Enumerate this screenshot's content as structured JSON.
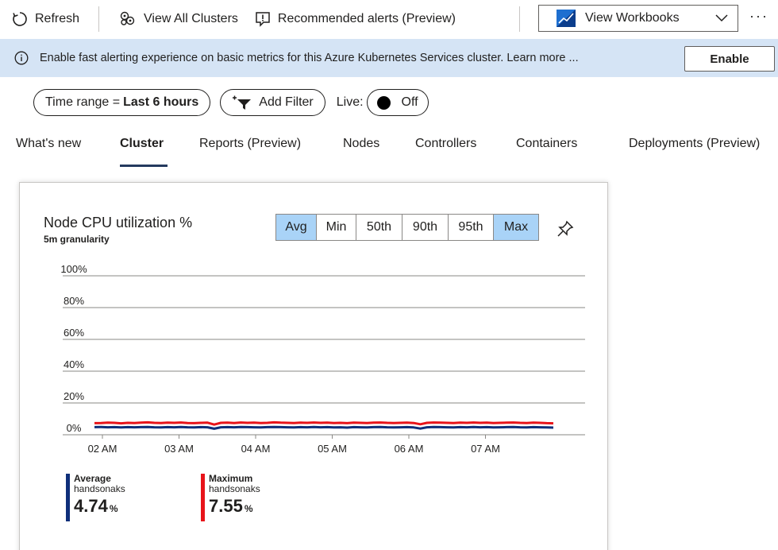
{
  "toolbar": {
    "refresh_label": "Refresh",
    "view_all_clusters_label": "View All Clusters",
    "recommended_alerts_label": "Recommended alerts (Preview)",
    "workbooks_label": "View Workbooks",
    "more_label": "···"
  },
  "banner": {
    "text": "Enable fast alerting experience on basic metrics for this Azure Kubernetes Services cluster. Learn more ...",
    "enable_label": "Enable"
  },
  "filters": {
    "time_range_prefix": "Time range =",
    "time_range_value": "Last 6 hours",
    "add_filter_label": "Add Filter",
    "live_label": "Live:",
    "live_state": "Off"
  },
  "tabs": [
    {
      "label": "What's new"
    },
    {
      "label": "Cluster"
    },
    {
      "label": "Reports (Preview)"
    },
    {
      "label": "Nodes"
    },
    {
      "label": "Controllers"
    },
    {
      "label": "Containers"
    },
    {
      "label": "Deployments (Preview)"
    }
  ],
  "active_tab": "Cluster",
  "card": {
    "title": "Node CPU utilization %",
    "subtitle": "5m granularity",
    "aggregations": [
      {
        "label": "Avg",
        "selected": true
      },
      {
        "label": "Min",
        "selected": false
      },
      {
        "label": "50th",
        "selected": false
      },
      {
        "label": "90th",
        "selected": false
      },
      {
        "label": "95th",
        "selected": false
      },
      {
        "label": "Max",
        "selected": true
      }
    ],
    "legend": [
      {
        "name": "Average",
        "sub": "handsonaks",
        "value": "4.74",
        "unit": "%",
        "color": "#0f2f7a"
      },
      {
        "name": "Maximum",
        "sub": "handsonaks",
        "value": "7.55",
        "unit": "%",
        "color": "#e8141a"
      }
    ]
  },
  "chart_data": {
    "type": "line",
    "title": "Node CPU utilization %",
    "subtitle": "5m granularity",
    "y_ticks": [
      "0%",
      "20%",
      "40%",
      "60%",
      "80%",
      "100%"
    ],
    "ylim": [
      0,
      100
    ],
    "x_ticks": [
      "02 AM",
      "03 AM",
      "04 AM",
      "05 AM",
      "06 AM",
      "07 AM"
    ],
    "grid": true,
    "legend_position": "bottom-left",
    "series": [
      {
        "name": "Maximum",
        "color": "#e8141a",
        "values": [
          7.3,
          7.4,
          7.6,
          7.5,
          7.2,
          7.5,
          7.4,
          7.6,
          7.8,
          7.5,
          7.4,
          7.6,
          7.5,
          7.7,
          7.4,
          7.3,
          7.5,
          7.6,
          6.4,
          7.5,
          7.6,
          7.4,
          7.7,
          7.5,
          7.6,
          7.4,
          7.5,
          7.8,
          7.6,
          7.5,
          7.4,
          7.6,
          7.5,
          7.7,
          7.5,
          7.6,
          7.4,
          7.5,
          7.3,
          7.6,
          7.5,
          7.4,
          7.6,
          7.7,
          7.5,
          7.4,
          7.5,
          7.6,
          7.4,
          6.6,
          7.5,
          7.7,
          7.6,
          7.5,
          7.4,
          7.6,
          7.5,
          7.7,
          7.5,
          7.6,
          7.4,
          7.5,
          7.6,
          7.7,
          7.5,
          7.4,
          7.6,
          7.5,
          7.3,
          7.2
        ]
      },
      {
        "name": "Average",
        "color": "#0f2f7a",
        "values": [
          4.8,
          4.9,
          4.7,
          4.8,
          4.6,
          4.8,
          4.7,
          4.8,
          4.9,
          4.7,
          4.6,
          4.8,
          4.7,
          4.9,
          4.7,
          4.6,
          4.8,
          4.7,
          3.8,
          4.7,
          4.8,
          4.7,
          4.9,
          4.8,
          4.7,
          4.6,
          4.8,
          4.9,
          4.8,
          4.7,
          4.6,
          4.8,
          4.7,
          4.9,
          4.7,
          4.8,
          4.6,
          4.7,
          4.5,
          4.8,
          4.7,
          4.6,
          4.8,
          4.9,
          4.7,
          4.6,
          4.7,
          4.8,
          4.6,
          3.9,
          4.7,
          4.9,
          4.8,
          4.7,
          4.6,
          4.8,
          4.7,
          4.9,
          4.7,
          4.8,
          4.6,
          4.7,
          4.8,
          4.9,
          4.7,
          4.6,
          4.8,
          4.7,
          4.6,
          4.5
        ]
      }
    ]
  }
}
